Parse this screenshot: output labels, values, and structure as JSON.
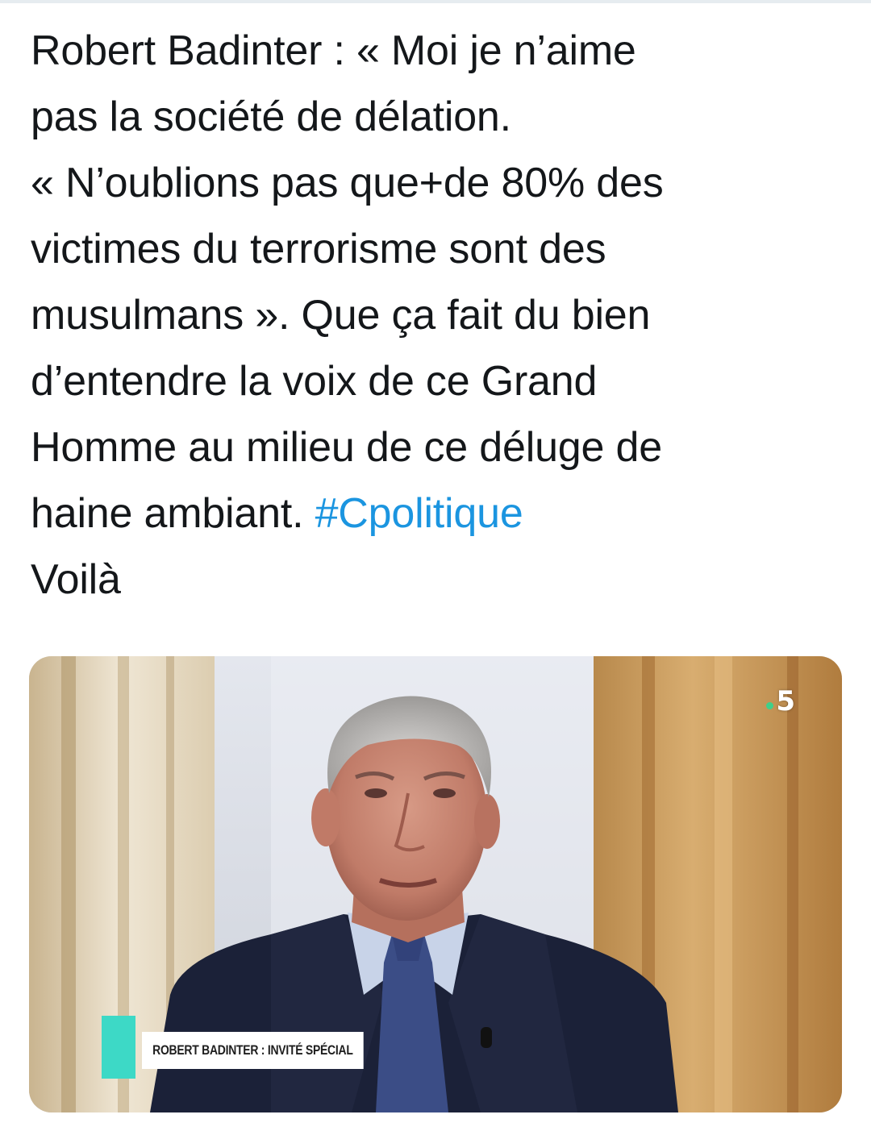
{
  "tweet": {
    "lines": [
      "Robert Badinter : « Moi je n’aime",
      "pas la société de délation.",
      "« N’oublions pas que+de 80% des",
      "victimes du terrorisme sont des",
      "musulmans ». Que ça fait du bien",
      "d’entendre la voix de ce Grand",
      "Homme au milieu de ce déluge de"
    ],
    "last_line_text": "haine ambiant. ",
    "hashtag": "#Cpolitique",
    "final_line": "Voilà",
    "link_color": "#1b95e0"
  },
  "media": {
    "chyron": "ROBERT BADINTER : INVITÉ SPÉCIAL",
    "channel_logo": "5",
    "accent_color": "#3dd9c6"
  }
}
